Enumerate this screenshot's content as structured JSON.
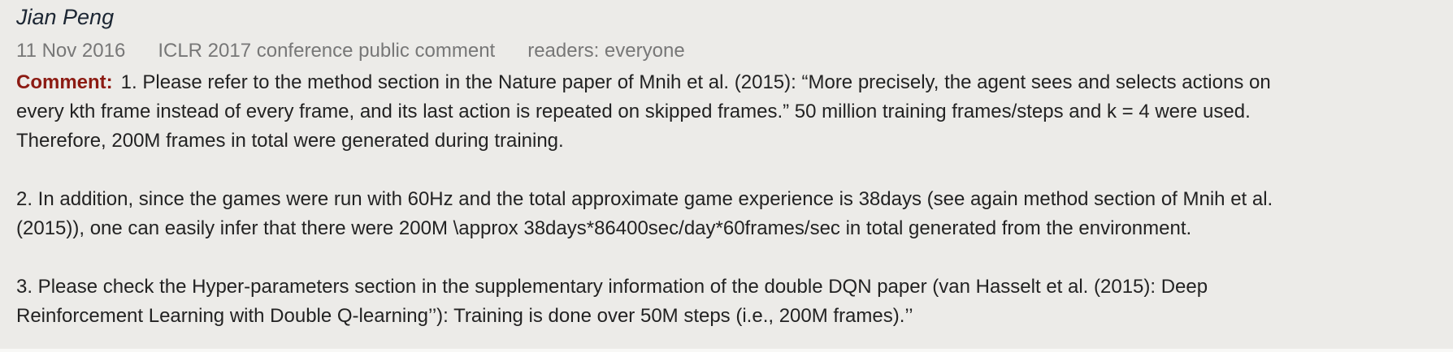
{
  "note": {
    "author": "Jian Peng",
    "date": "11 Nov 2016",
    "invitation": "ICLR 2017 conference public comment",
    "readers": "readers: everyone",
    "comment_label": "Comment:",
    "paragraphs": [
      "1. Please refer to the method section in the Nature paper of Mnih et al. (2015): “More precisely, the agent sees and selects actions on\nevery kth frame instead of every frame, and its last action is repeated on skipped frames.” 50 million training frames/steps and k = 4 were used.\nTherefore, 200M frames in total were generated during training.",
      "2. In addition, since the games were run with 60Hz and the total approximate game experience is 38days (see again method section of Mnih et al.\n(2015)), one can easily infer that there were 200M \\approx 38days*86400sec/day*60frames/sec in total generated from the environment.",
      "3. Please check the Hyper-parameters section in the supplementary information of the double DQN paper (van Hasselt et al. (2015): Deep\nReinforcement Learning with Double Q-learning’’): Training is done over 50M steps (i.e., 200M frames).’’"
    ]
  }
}
